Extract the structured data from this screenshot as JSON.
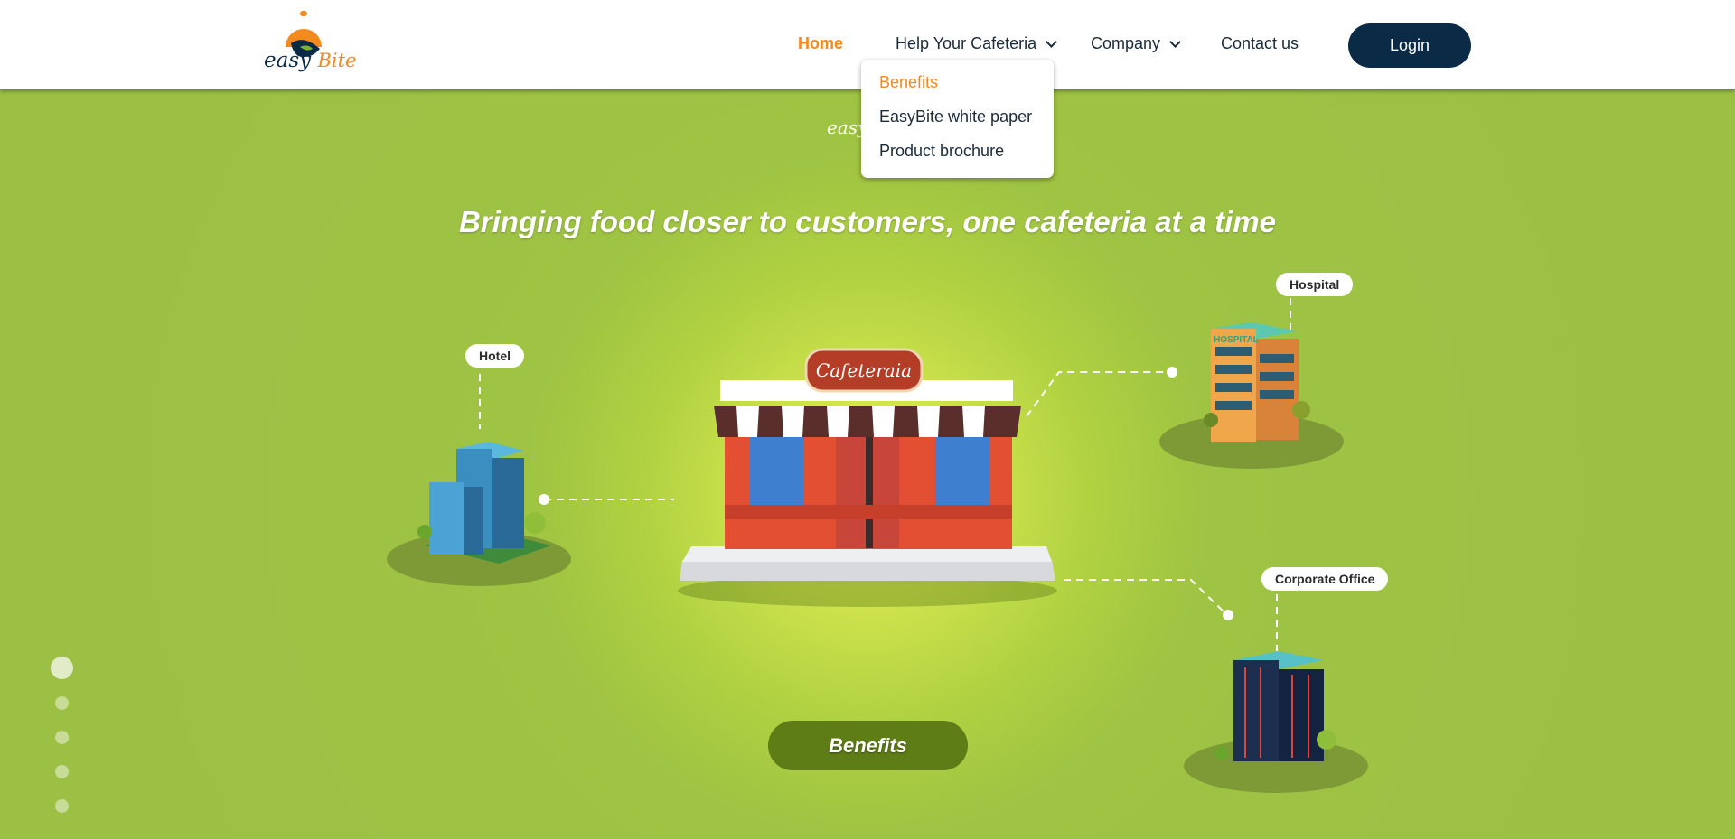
{
  "header": {
    "logo": {
      "word1": "easy",
      "word2": "Bite"
    },
    "nav": {
      "home": "Home",
      "help": "Help Your Cafeteria",
      "company": "Company",
      "contact": "Contact us"
    },
    "login": "Login",
    "dropdown": [
      "Benefits",
      "EasyBite white paper",
      "Product brochure"
    ]
  },
  "hero": {
    "tagline": "Bringing food closer to customers, one cafeteria at a time",
    "cafeteria_sign": "Cafeteraia",
    "locations": {
      "hotel": "Hotel",
      "hospital": "Hospital",
      "corporate": "Corporate Office"
    },
    "hospital_sign": "HOSPITAL",
    "cta": "Benefits",
    "slide_count": 5,
    "active_slide": 1
  },
  "colors": {
    "accent_orange": "#f28a1e",
    "navy": "#0b2a45",
    "hero_green": "#9cc044",
    "cta_green": "#5e7d16"
  },
  "icons": [
    "chevron-down-icon",
    "chevron-down-icon"
  ]
}
